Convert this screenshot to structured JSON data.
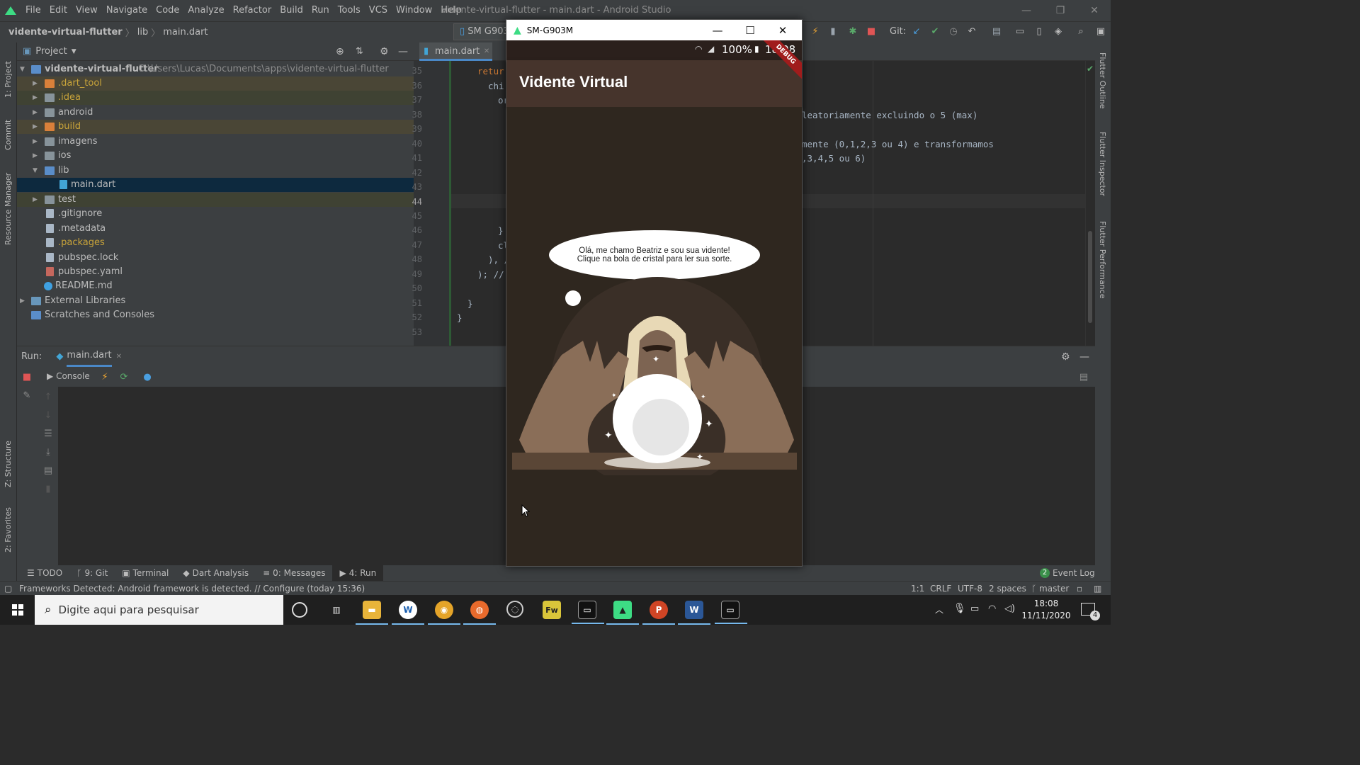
{
  "menubar": {
    "items": [
      "File",
      "Edit",
      "View",
      "Navigate",
      "Code",
      "Analyze",
      "Refactor",
      "Build",
      "Run",
      "Tools",
      "VCS",
      "Window",
      "Help"
    ],
    "window_title": "vidente-virtual-flutter - main.dart - Android Studio"
  },
  "navbar": {
    "project": "vidente-virtual-flutter",
    "folder": "lib",
    "file": "main.dart",
    "device": "SM G903",
    "git_label": "Git:"
  },
  "left_strip": {
    "project": "1: Project",
    "commit": "Commit",
    "resource_manager": "Resource Manager",
    "structure": "Z: Structure",
    "favorites": "2: Favorites"
  },
  "right_strip": {
    "flutter_outline": "Flutter Outline",
    "flutter_inspector": "Flutter Inspector",
    "flutter_performance": "Flutter Performance"
  },
  "project_panel": {
    "title": "Project",
    "root_name": "vidente-virtual-flutter",
    "root_path": "C:\\Users\\Lucas\\Documents\\apps\\vidente-virtual-flutter",
    "items": [
      {
        "label": ".dart_tool"
      },
      {
        "label": ".idea"
      },
      {
        "label": "android"
      },
      {
        "label": "build"
      },
      {
        "label": "imagens"
      },
      {
        "label": "ios"
      },
      {
        "label": "lib"
      },
      {
        "label": "main.dart"
      },
      {
        "label": "test"
      },
      {
        "label": ".gitignore"
      },
      {
        "label": ".metadata"
      },
      {
        "label": ".packages"
      },
      {
        "label": "pubspec.lock"
      },
      {
        "label": "pubspec.yaml"
      },
      {
        "label": "README.md"
      },
      {
        "label": "External Libraries"
      },
      {
        "label": "Scratches and Consoles"
      }
    ]
  },
  "editor": {
    "tab": "main.dart",
    "line_numbers": [
      "35",
      "36",
      "37",
      "38",
      "39",
      "40",
      "41",
      "42",
      "43",
      "44",
      "45",
      "46",
      "47",
      "48",
      "49",
      "50",
      "51",
      "52",
      "53"
    ],
    "code": {
      "l35": "retur",
      "l36": "chi",
      "l37": "or",
      "l38": "leatoriamente excluindo o 5 (max)",
      "l40a": "mente (0,1,2,3 ou 4) e transformamos",
      "l41": ",3,4,5 ou 6)",
      "l46": "}",
      "l47": "cl",
      "l48": "), /",
      "l49": "); //",
      "l51": "}",
      "l52": "}"
    }
  },
  "run_panel": {
    "label": "Run:",
    "tab": "main.dart",
    "console": "Console"
  },
  "tool_tabs": [
    "TODO",
    "9: Git",
    "Terminal",
    "Dart Analysis",
    "0: Messages",
    "4: Run"
  ],
  "event_log": {
    "count": "2",
    "label": "Event Log"
  },
  "status": {
    "message": "Frameworks Detected: Android framework is detected. // Configure (today 15:36)",
    "position": "1:1",
    "line_sep": "CRLF",
    "encoding": "UTF-8",
    "indent": "2 spaces",
    "branch": "master"
  },
  "taskbar": {
    "search_placeholder": "Digite aqui para pesquisar",
    "time": "18:08",
    "date": "11/11/2020",
    "notifications": "4"
  },
  "emulator": {
    "window_title": "SM-G903M",
    "battery": "100%",
    "clock": "18:08",
    "debug": "DEBUG",
    "app_title": "Vidente Virtual",
    "bubble_line1": "Olá, me chamo Beatriz e sou sua vidente!",
    "bubble_line2": "Clique na bola de cristal para ler sua sorte."
  },
  "colors": {
    "ide_bg": "#2b2b2b",
    "panel_bg": "#3c3f41",
    "selection": "#0d293e",
    "app_bar": "#46342c",
    "app_body": "#2f271f"
  }
}
